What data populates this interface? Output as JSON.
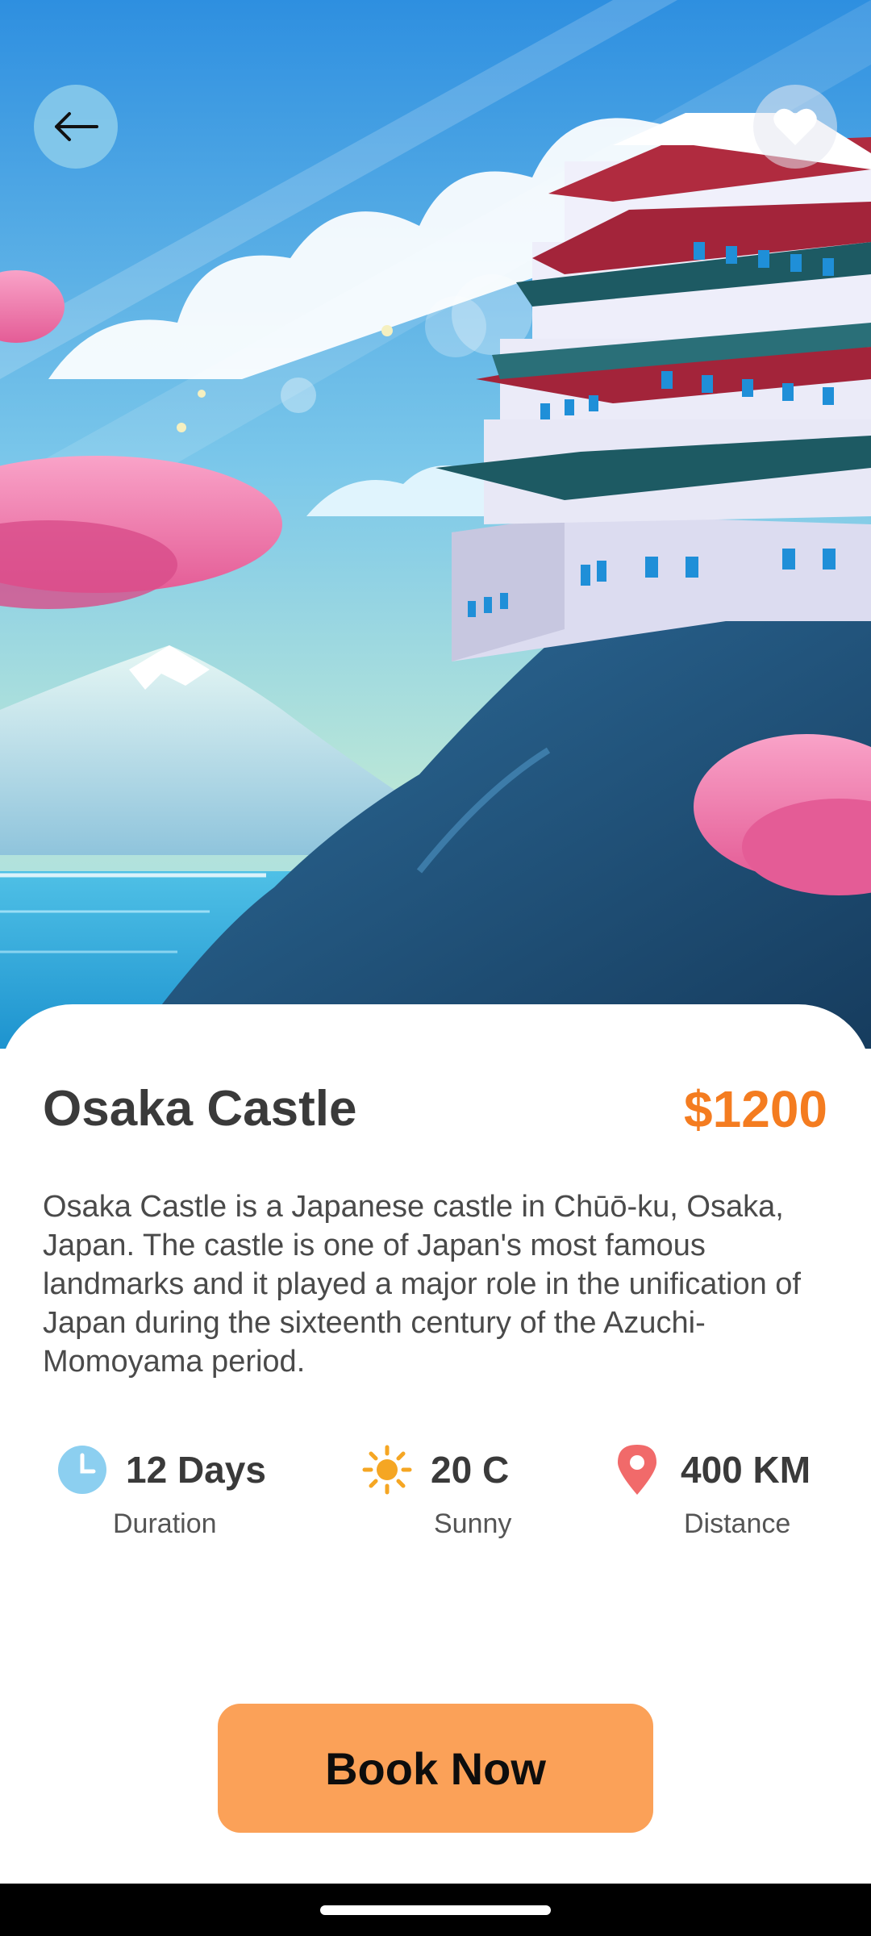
{
  "header": {
    "back_icon": "arrow-left-icon",
    "favorite_icon": "heart-icon"
  },
  "destination": {
    "title": "Osaka Castle",
    "price": "$1200",
    "description": "Osaka Castle is a Japanese castle in Chūō-ku, Osaka, Japan. The castle is one of Japan's most famous landmarks and it played a major role in the unification of Japan during the sixteenth century of the Azuchi-Momoyama period."
  },
  "stats": [
    {
      "icon": "clock-icon",
      "value": "12 Days",
      "label": "Duration",
      "color": "#8ccff0"
    },
    {
      "icon": "sun-icon",
      "value": "20 C",
      "label": "Sunny",
      "color": "#f5a623"
    },
    {
      "icon": "location-pin-icon",
      "value": "400 KM",
      "label": "Distance",
      "color": "#f16a6a"
    }
  ],
  "actions": {
    "book_label": "Book Now"
  },
  "colors": {
    "accent": "#f47c20",
    "button": "#fba158"
  }
}
